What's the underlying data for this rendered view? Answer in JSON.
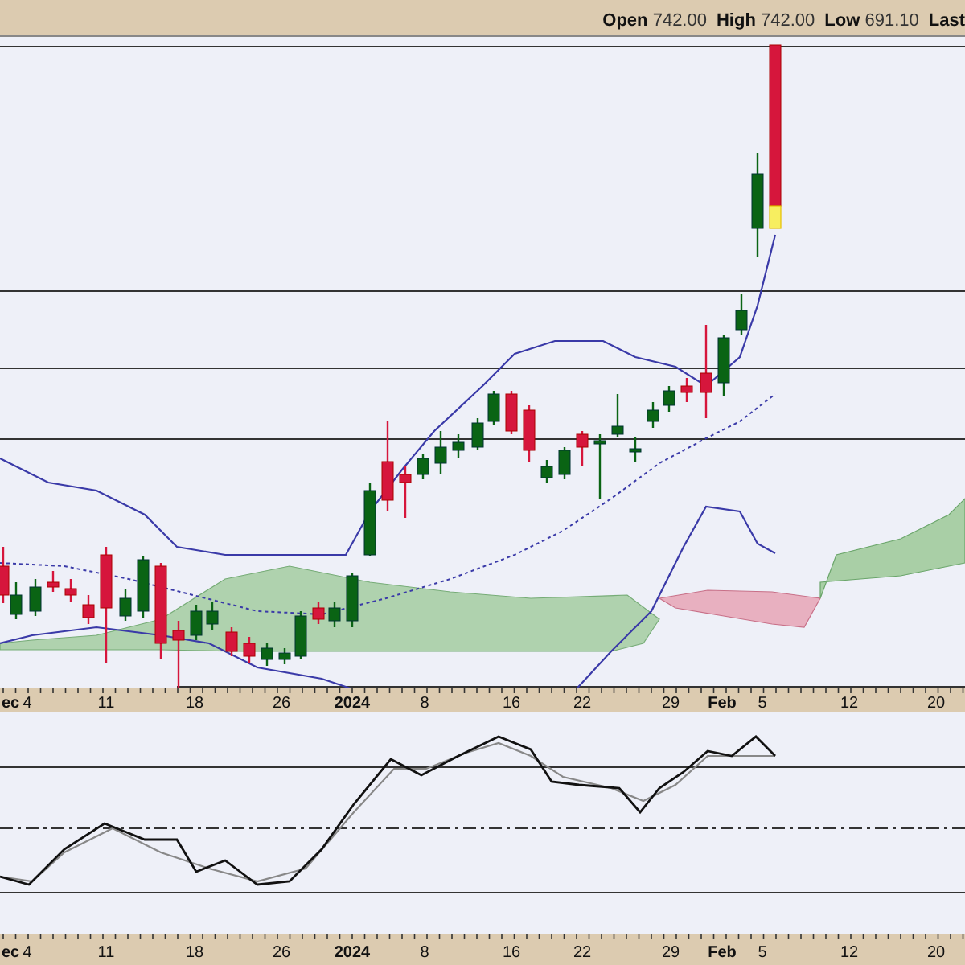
{
  "header": {
    "items": [
      {
        "label": "Open",
        "value": "742.00"
      },
      {
        "label": "High",
        "value": "742.00"
      },
      {
        "label": "Low",
        "value": "691.10"
      },
      {
        "label": "Last"
      }
    ]
  },
  "price_axis": {
    "labels": [
      {
        "text": "ec",
        "major": true
      },
      {
        "text": "4",
        "major": false
      },
      {
        "text": "11",
        "major": false
      },
      {
        "text": "18",
        "major": false
      },
      {
        "text": "26",
        "major": false
      },
      {
        "text": "2024",
        "major": true
      },
      {
        "text": "8",
        "major": false
      },
      {
        "text": "16",
        "major": false
      },
      {
        "text": "22",
        "major": false
      },
      {
        "text": "29",
        "major": false
      },
      {
        "text": "Feb",
        "major": true
      },
      {
        "text": "5",
        "major": false
      },
      {
        "text": "12",
        "major": false
      },
      {
        "text": "20",
        "major": false
      }
    ]
  },
  "oscillator_axis": {
    "labels": [
      {
        "text": "ec",
        "major": true
      },
      {
        "text": "4",
        "major": false
      },
      {
        "text": "11",
        "major": false
      },
      {
        "text": "18",
        "major": false
      },
      {
        "text": "26",
        "major": false
      },
      {
        "text": "2024",
        "major": true
      },
      {
        "text": "8",
        "major": false
      },
      {
        "text": "16",
        "major": false
      },
      {
        "text": "22",
        "major": false
      },
      {
        "text": "29",
        "major": false
      },
      {
        "text": "Feb",
        "major": true
      },
      {
        "text": "5",
        "major": false
      },
      {
        "text": "12",
        "major": false
      },
      {
        "text": "20",
        "major": false
      }
    ]
  }
}
